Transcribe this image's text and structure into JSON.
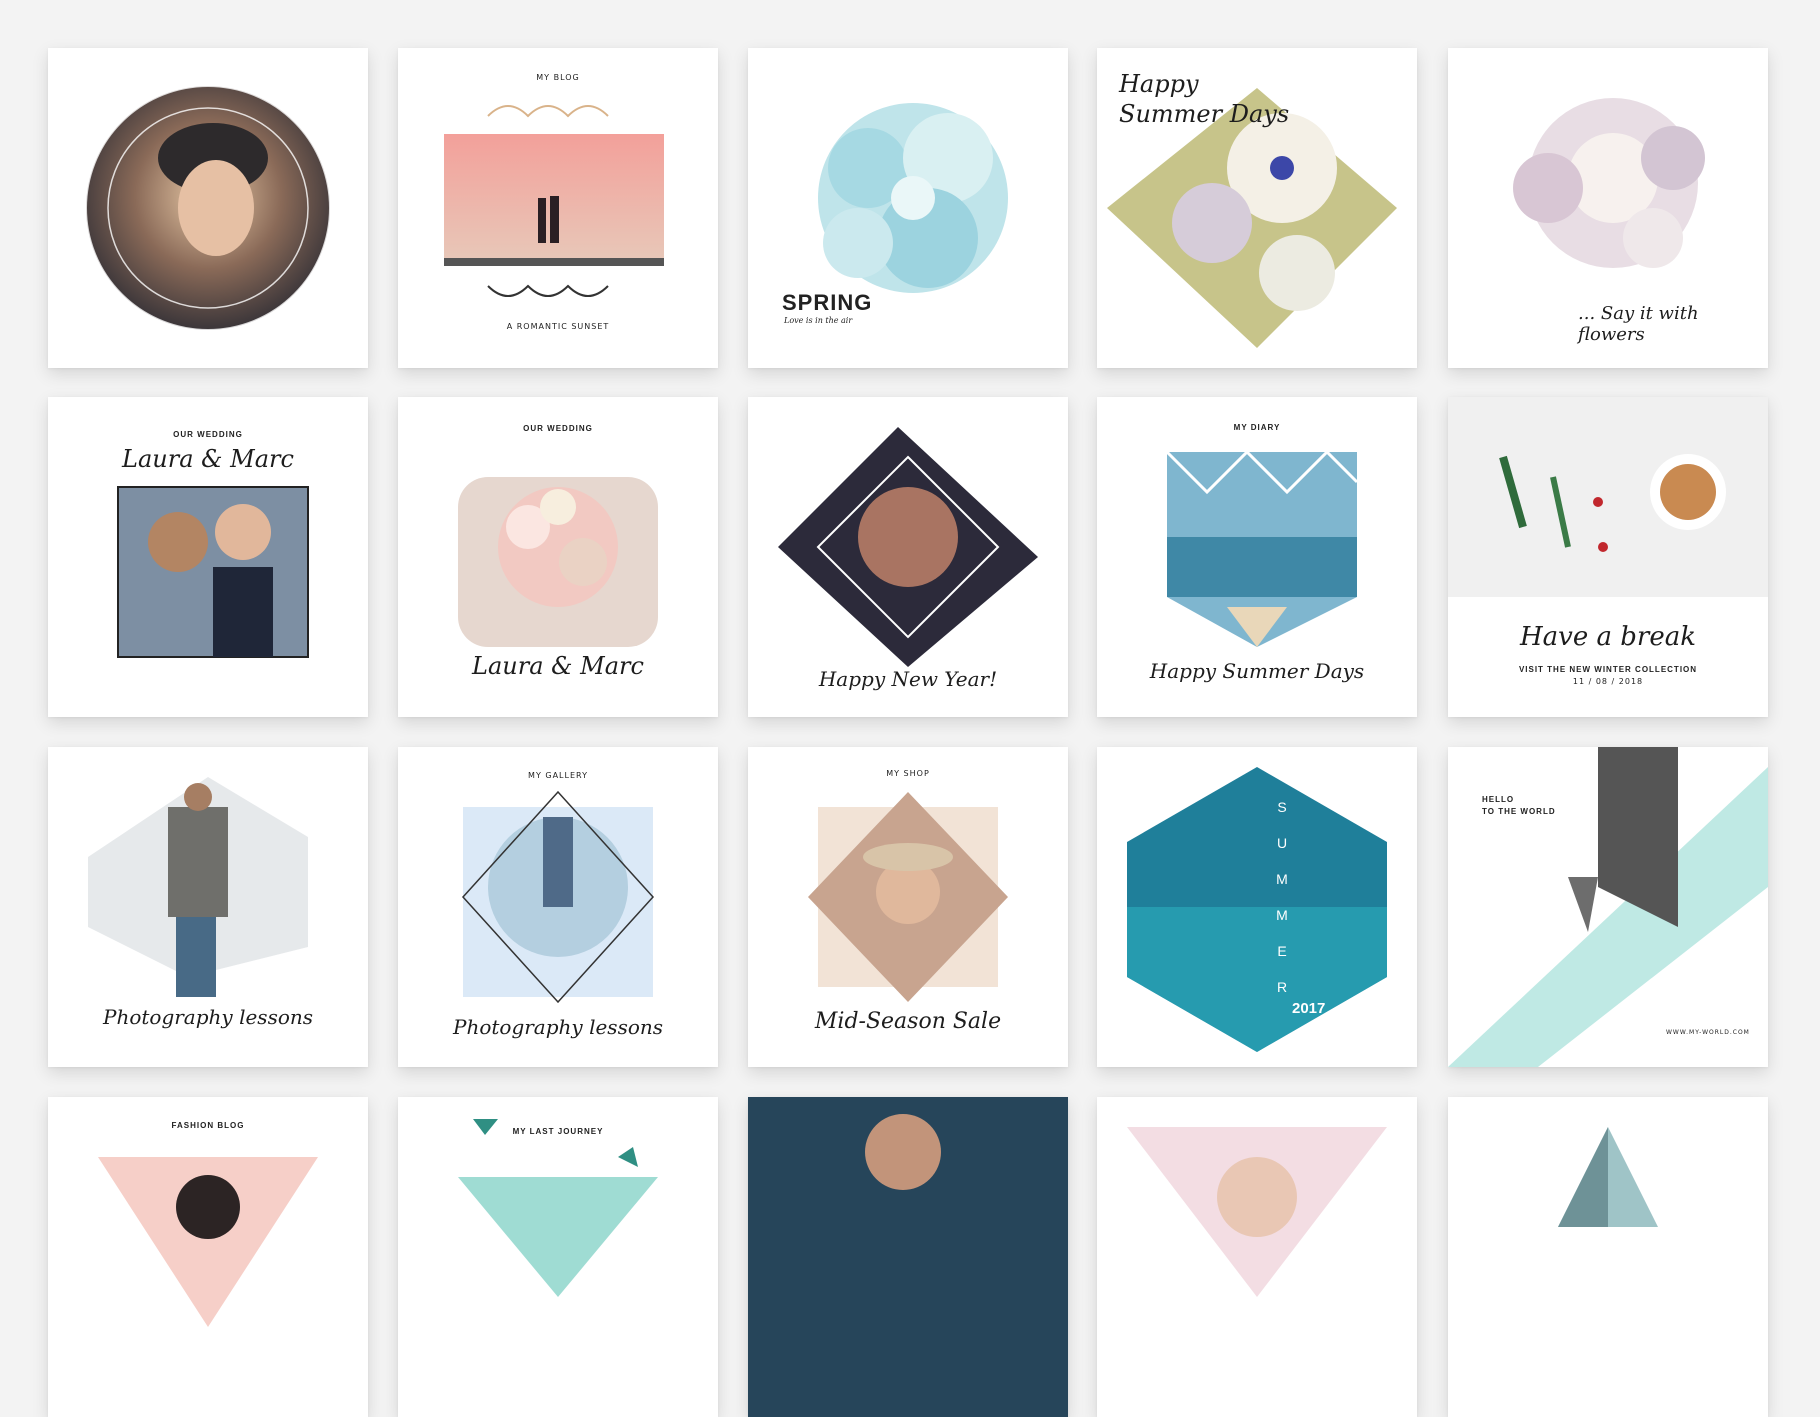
{
  "cards": [
    {
      "row": 1,
      "col": 1,
      "texts": []
    },
    {
      "row": 1,
      "col": 2,
      "texts": [
        "MY BLOG",
        "A ROMANTIC SUNSET"
      ]
    },
    {
      "row": 1,
      "col": 3,
      "texts": [
        "SPRING",
        "Love is in the air"
      ]
    },
    {
      "row": 1,
      "col": 4,
      "texts": [
        "Happy",
        "Summer Days"
      ]
    },
    {
      "row": 1,
      "col": 5,
      "texts": [
        "... Say it with flowers"
      ]
    },
    {
      "row": 2,
      "col": 1,
      "texts": [
        "OUR WEDDING",
        "Laura & Marc"
      ]
    },
    {
      "row": 2,
      "col": 2,
      "texts": [
        "OUR WEDDING",
        "Laura & Marc"
      ]
    },
    {
      "row": 2,
      "col": 3,
      "texts": [
        "Happy New Year!"
      ]
    },
    {
      "row": 2,
      "col": 4,
      "texts": [
        "MY DIARY",
        "Happy Summer Days"
      ]
    },
    {
      "row": 2,
      "col": 5,
      "texts": [
        "Have a break",
        "VISIT THE NEW WINTER COLLECTION",
        "11 / 08 / 2018"
      ]
    },
    {
      "row": 3,
      "col": 1,
      "texts": [
        "Photography lessons"
      ]
    },
    {
      "row": 3,
      "col": 2,
      "texts": [
        "MY GALLERY",
        "Photography lessons"
      ]
    },
    {
      "row": 3,
      "col": 3,
      "texts": [
        "MY SHOP",
        "Mid-Season Sale"
      ]
    },
    {
      "row": 3,
      "col": 4,
      "texts": [
        "S",
        "U",
        "M",
        "M",
        "E",
        "R",
        "2017"
      ]
    },
    {
      "row": 3,
      "col": 5,
      "texts": [
        "HELLO",
        "TO THE WORLD",
        "WWW.MY-WORLD.COM"
      ]
    },
    {
      "row": 4,
      "col": 1,
      "texts": [
        "FASHION BLOG"
      ]
    },
    {
      "row": 4,
      "col": 2,
      "texts": [
        "MY LAST JOURNEY"
      ]
    },
    {
      "row": 4,
      "col": 3,
      "texts": []
    },
    {
      "row": 4,
      "col": 4,
      "texts": []
    },
    {
      "row": 4,
      "col": 5,
      "texts": []
    }
  ],
  "colors": {
    "background": "#f3f3f3",
    "card": "#ffffff",
    "teal": "#3a8fa4",
    "mint": "#9fdcd3",
    "blush": "#f2b3a2"
  }
}
